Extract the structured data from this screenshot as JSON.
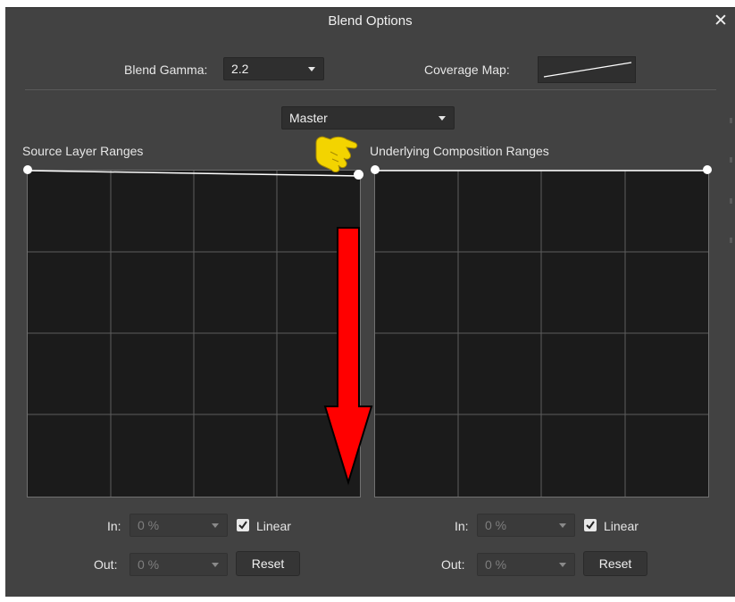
{
  "dialog": {
    "title": "Blend Options",
    "close_icon": "close-icon"
  },
  "blend_gamma": {
    "label": "Blend Gamma:",
    "value": "2.2"
  },
  "coverage_map": {
    "label": "Coverage Map:"
  },
  "channel": {
    "value": "Master"
  },
  "source_ranges": {
    "title": "Source Layer Ranges",
    "in_label": "In:",
    "in_value": "0 %",
    "out_label": "Out:",
    "out_value": "0 %",
    "linear_label": "Linear",
    "linear_checked": true,
    "reset_label": "Reset"
  },
  "underlying_ranges": {
    "title": "Underlying Composition Ranges",
    "in_label": "In:",
    "in_value": "0 %",
    "out_label": "Out:",
    "out_value": "0 %",
    "linear_label": "Linear",
    "linear_checked": true,
    "reset_label": "Reset"
  },
  "annotations": {
    "cursor_icon": "hand-pointer-icon",
    "arrow_icon": "down-arrow-icon",
    "arrow_color": "#ff0000",
    "cursor_color": "#f3d400"
  },
  "colors": {
    "dialog_bg": "#424242",
    "graph_bg": "#1b1b1b",
    "grid": "#5c5c5c",
    "curve": "#ffffff"
  }
}
